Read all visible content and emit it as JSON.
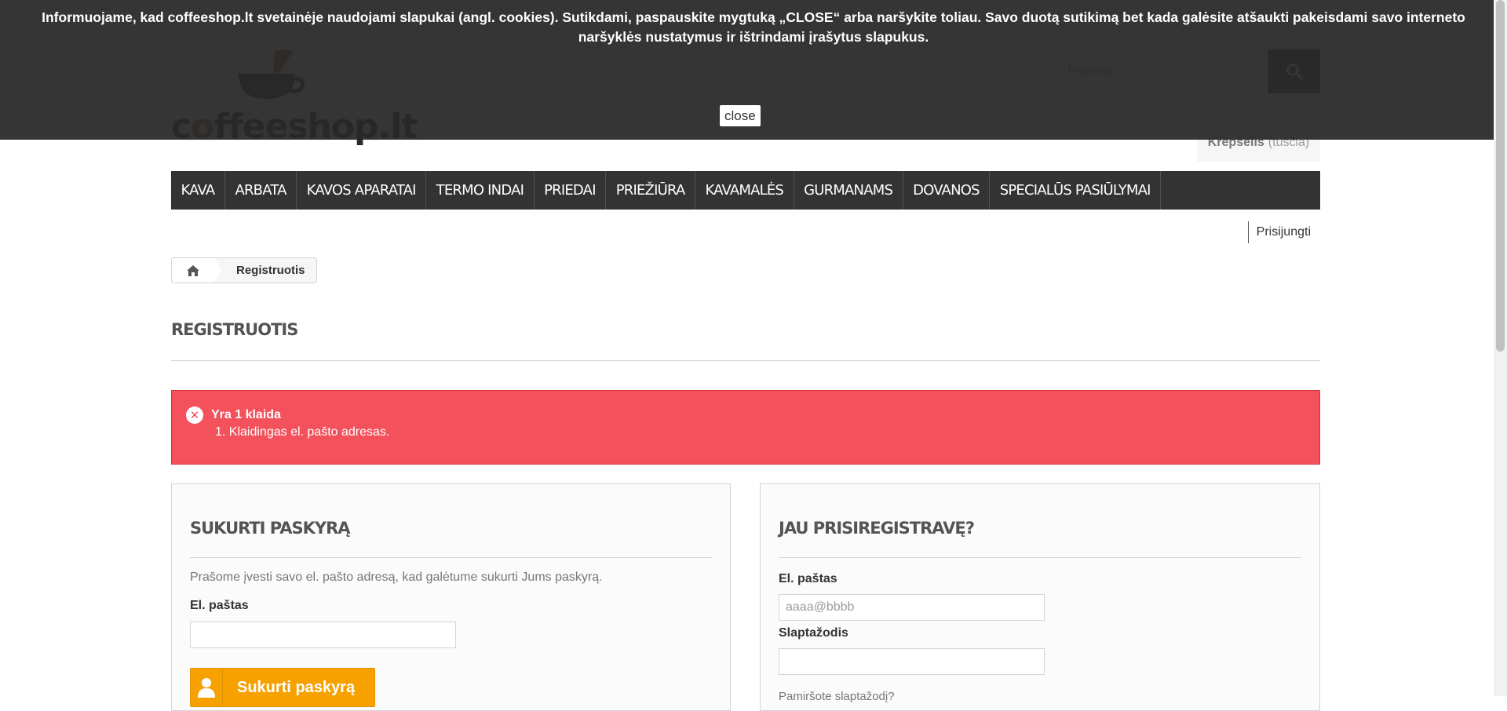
{
  "cookie_banner": {
    "text": "Informuojame, kad coffeeshop.lt svetainėje naudojami slapukai (angl. cookies). Sutikdami, paspauskite mygtuką „CLOSE“ arba naršykite toliau. Savo duotą sutikimą bet kada galėsite atšaukti pakeisdami savo interneto naršyklės nustatymus ir ištrindami įrašytus slapukus.",
    "close_label": "close"
  },
  "header": {
    "logo_text_dark": "c",
    "logo_text_brown": "o",
    "logo_text_rest": "ffeeshop.lt",
    "search_placeholder": "Paieška",
    "cart_label": "Krepšelis",
    "cart_status": "(tuščia)"
  },
  "menu": {
    "items": [
      {
        "label": "KAVA"
      },
      {
        "label": "ARBATA"
      },
      {
        "label": "KAVOS APARATAI"
      },
      {
        "label": "TERMO INDAI"
      },
      {
        "label": "PRIEDAI"
      },
      {
        "label": "PRIEŽIŪRA"
      },
      {
        "label": "KAVAMALĖS"
      },
      {
        "label": "GURMANAMS"
      },
      {
        "label": "DOVANOS"
      },
      {
        "label": "SPECIALŪS PASIŪLYMAI"
      }
    ]
  },
  "login_link": "Prisijungti",
  "breadcrumb": {
    "current": "Registruotis"
  },
  "page_title": "REGISTRUOTIS",
  "alert": {
    "title": "Yra 1 klaida",
    "items": [
      "1. Klaidingas el. pašto adresas."
    ]
  },
  "create_account": {
    "title": "SUKURTI PASKYRĄ",
    "description": "Prašome įvesti savo el. pašto adresą, kad galėtume sukurti Jums paskyrą.",
    "email_label": "El. paštas",
    "email_value": "",
    "button_label": "Sukurti paskyrą"
  },
  "login_box": {
    "title": "JAU PRISIREGISTRAVĘ?",
    "email_label": "El. paštas",
    "email_placeholder": "aaaa@bbbb",
    "password_label": "Slaptažodis",
    "password_value": "",
    "forgot_label": "Pamiršote slaptažodį?"
  },
  "colors": {
    "menu_bg": "#333333",
    "alert_bg": "#f3515c",
    "button_orange": "#f7a100"
  }
}
